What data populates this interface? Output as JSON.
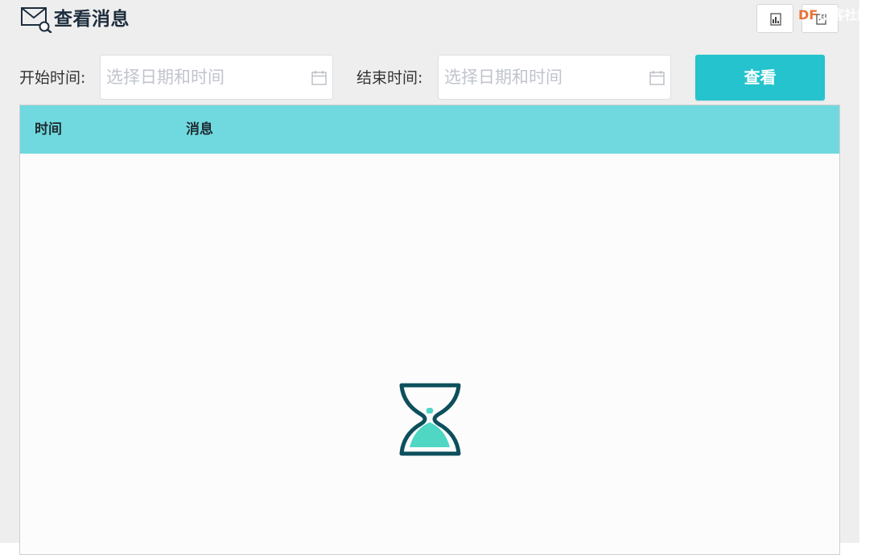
{
  "header": {
    "title": "查看消息",
    "icon": "mail-search-icon",
    "toolbar": [
      {
        "icon": "chart-icon"
      },
      {
        "icon": "export-icon"
      }
    ],
    "watermark": {
      "text_colored": "DF",
      "text_rest": "创客社区",
      "accent": "#e8743b"
    }
  },
  "filters": {
    "start_label": "开始时间:",
    "start_placeholder": "选择日期和时间",
    "end_label": "结束时间:",
    "end_placeholder": "选择日期和时间",
    "calendar_icon": "calendar-icon",
    "view_button": "查看"
  },
  "table": {
    "columns": [
      "时间",
      "消息"
    ],
    "rows": [],
    "loading_icon": "hourglass-icon"
  },
  "colors": {
    "accent": "#25c3cd",
    "table_header": "#70d9df",
    "hourglass_frame": "#0d4f5c",
    "hourglass_sand": "#4fd7c4"
  }
}
